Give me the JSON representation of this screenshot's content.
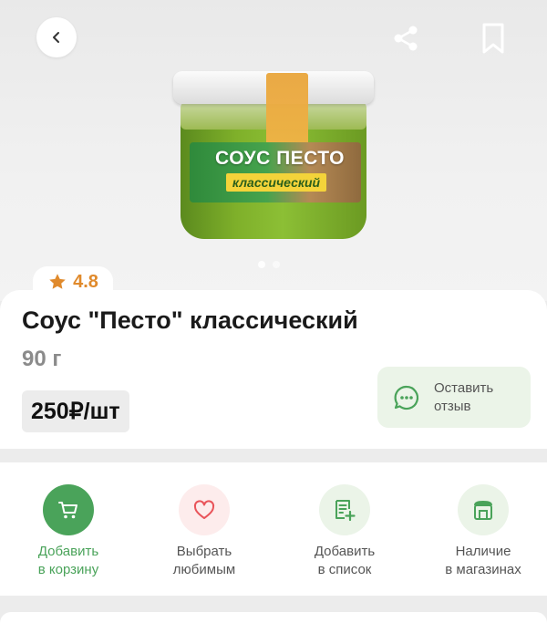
{
  "product": {
    "rating": "4.8",
    "title": "Соус \"Песто\" классический",
    "weight": "90 г",
    "price": "250₽/шт",
    "jar_label_line1": "СОУС ПЕСТО",
    "jar_label_line2": "классический"
  },
  "gallery": {
    "image_count": 2,
    "active_index": 0
  },
  "review": {
    "line1": "Оставить",
    "line2": "отзыв"
  },
  "actions": [
    {
      "line1": "Добавить",
      "line2": "в корзину",
      "icon": "cart-icon",
      "color": "#4aa35a",
      "active": true
    },
    {
      "line1": "Выбрать",
      "line2": "любимым",
      "icon": "heart-icon",
      "color": "#e9545a",
      "active": false
    },
    {
      "line1": "Добавить",
      "line2": "в список",
      "icon": "list-add-icon",
      "color": "#4aa35a",
      "active": false
    },
    {
      "line1": "Наличие",
      "line2": "в магазинах",
      "icon": "store-icon",
      "color": "#4aa35a",
      "active": false
    }
  ],
  "colors": {
    "accent": "#4aa35a",
    "rating": "#e08a2c",
    "favorite": "#e9545a"
  }
}
